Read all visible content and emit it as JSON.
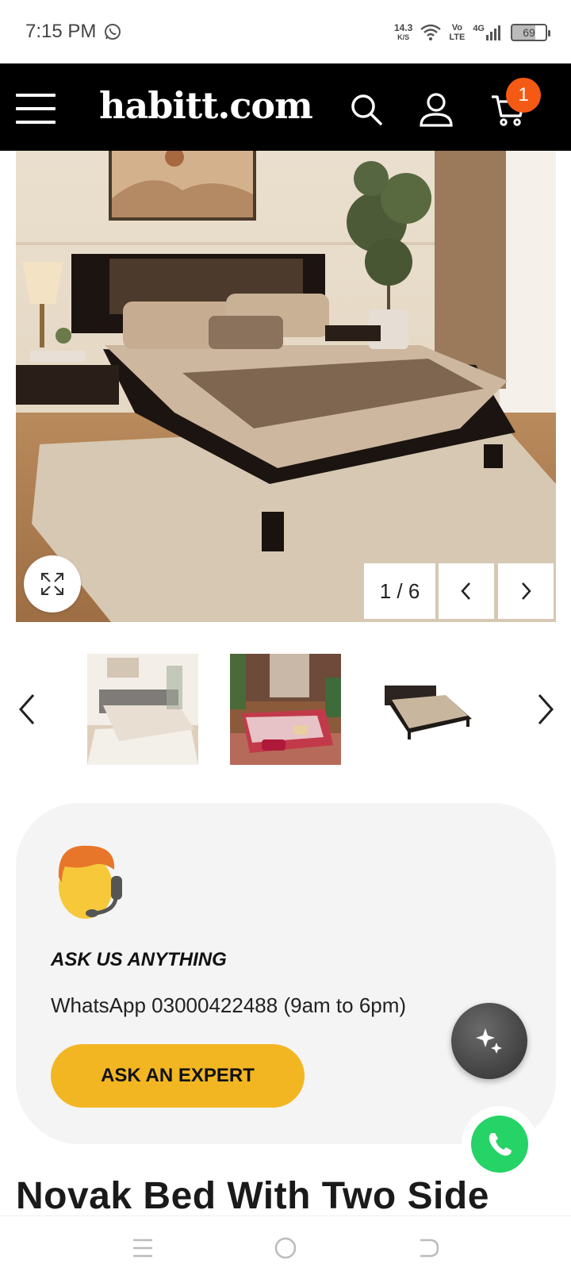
{
  "status_bar": {
    "time": "7:15 PM",
    "net_speed_value": "14.3",
    "net_speed_unit": "K/S",
    "volte_top": "Vo",
    "volte_bottom": "LTE",
    "network": "4G",
    "battery": "69"
  },
  "header": {
    "logo": "habitt.com",
    "cart_count": "1",
    "icons": [
      "menu-icon",
      "search-icon",
      "user-icon",
      "cart-icon"
    ]
  },
  "gallery": {
    "counter": "1 / 6",
    "progress": {
      "current": 1,
      "total": 6
    },
    "icons": [
      "expand-icon",
      "chevron-left-icon",
      "chevron-right-icon"
    ]
  },
  "thumbnails": {
    "items": [
      "thumbnail-bedroom-neutral",
      "thumbnail-bedroom-red",
      "thumbnail-bed-frame"
    ]
  },
  "ask_card": {
    "title": "ASK US ANYTHING",
    "contact": "WhatsApp 03000422488 (9am to 6pm)",
    "button_label": "ASK AN EXPERT"
  },
  "product": {
    "title": "Novak Bed With Two Side"
  },
  "colors": {
    "header_bg": "#000000",
    "cart_badge": "#f55a14",
    "ask_button": "#f3b623",
    "whatsapp": "#25d366"
  }
}
